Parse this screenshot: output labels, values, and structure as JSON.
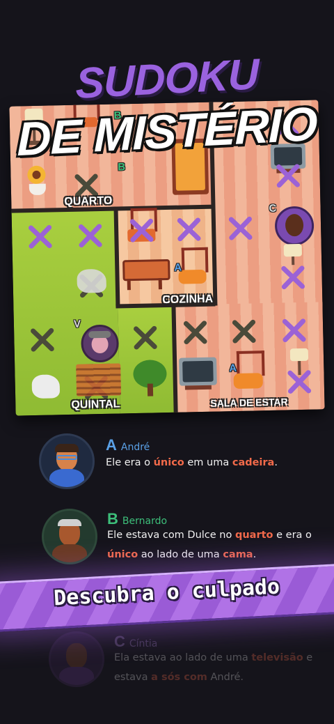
{
  "title": {
    "line1": "SUDOKU",
    "line2": "DE MISTÉRIO"
  },
  "board": {
    "rooms": {
      "quarto": "QUARTO",
      "cozinha": "COZINHA",
      "quintal": "QUINTAL",
      "sala": "SALA DE ESTAR"
    },
    "letters": {
      "b1": "B",
      "b2": "B",
      "a1": "A",
      "a2": "A",
      "v": "V",
      "c": "C"
    }
  },
  "clues": [
    {
      "letter": "A",
      "name": "André",
      "color": "#5aa0e6",
      "text_parts": [
        "Ele era o ",
        "único",
        " em uma ",
        "cadeira",
        "."
      ]
    },
    {
      "letter": "B",
      "name": "Bernardo",
      "color": "#3dbf7a",
      "line1_parts": [
        "Ele estava com Dulce no ",
        "quarto",
        " e era o"
      ],
      "line2_parts": [
        "único",
        " ao lado de uma ",
        "cama",
        "."
      ]
    },
    {
      "letter": "C",
      "name": "Cíntia",
      "color": "#b08ad8",
      "line1_parts": [
        "Ela estava ao lado de uma ",
        "televisão",
        " e"
      ],
      "line2_parts": [
        "estava ",
        "a sós com",
        " André."
      ]
    }
  ],
  "banner": {
    "label": "Descubra o culpado"
  },
  "colors": {
    "accent": "#9a62df",
    "highlight": "#f26a4a",
    "mark": "#9b62d6"
  }
}
